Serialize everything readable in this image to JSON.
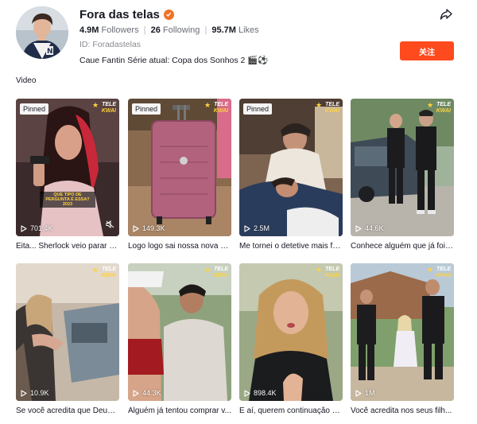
{
  "profile": {
    "name": "Fora das telas",
    "followers_count": "4.9M",
    "followers_label": "Followers",
    "following_count": "26",
    "following_label": "Following",
    "likes_count": "95.7M",
    "likes_label": "Likes",
    "id_text": "ID: Foradastelas",
    "bio": "Caue Fantin Série atual: Copa dos Sonhos 2 🎬⚽",
    "follow_label": "关注",
    "accent_color": "#fe4a1d",
    "verified_icon": "verified-badge-icon"
  },
  "section": {
    "title": "Video"
  },
  "videos": [
    {
      "pinned": "Pinned",
      "views": "701.4K",
      "title": "Eita... Sherlock veio parar n...",
      "logo_top": "TELE",
      "logo_bottom": "KWAI",
      "caption": "QUE TIPO DE PERGUNTA É ESSA? 2023",
      "muted": true
    },
    {
      "pinned": "Pinned",
      "views": "149.3K",
      "title": "Logo logo sai nossa nova sé...",
      "logo_top": "TELE",
      "logo_bottom": "KWAI"
    },
    {
      "pinned": "Pinned",
      "views": "2.5M",
      "title": "Me tornei o detetive mais fa...",
      "logo_top": "TELE",
      "logo_bottom": "KWAI"
    },
    {
      "views": "44.6K",
      "title": "Conhece alguém que já foi ...",
      "logo_top": "TELE",
      "logo_bottom": "KWAI"
    },
    {
      "views": "10.9K",
      "title": "Se você acredita que Deus ...",
      "logo_top": "TELE",
      "logo_bottom": "KWAI"
    },
    {
      "views": "44.3K",
      "title": "Alguém já tentou comprar v...",
      "logo_top": "TELE",
      "logo_bottom": "KWAI"
    },
    {
      "views": "898.4K",
      "title": "E aí, querem continuação d...",
      "logo_top": "TELE",
      "logo_bottom": "KWAI"
    },
    {
      "views": "1M",
      "title": "Você acredita nos seus filh...",
      "logo_top": "TELE",
      "logo_bottom": "KWAI"
    }
  ]
}
